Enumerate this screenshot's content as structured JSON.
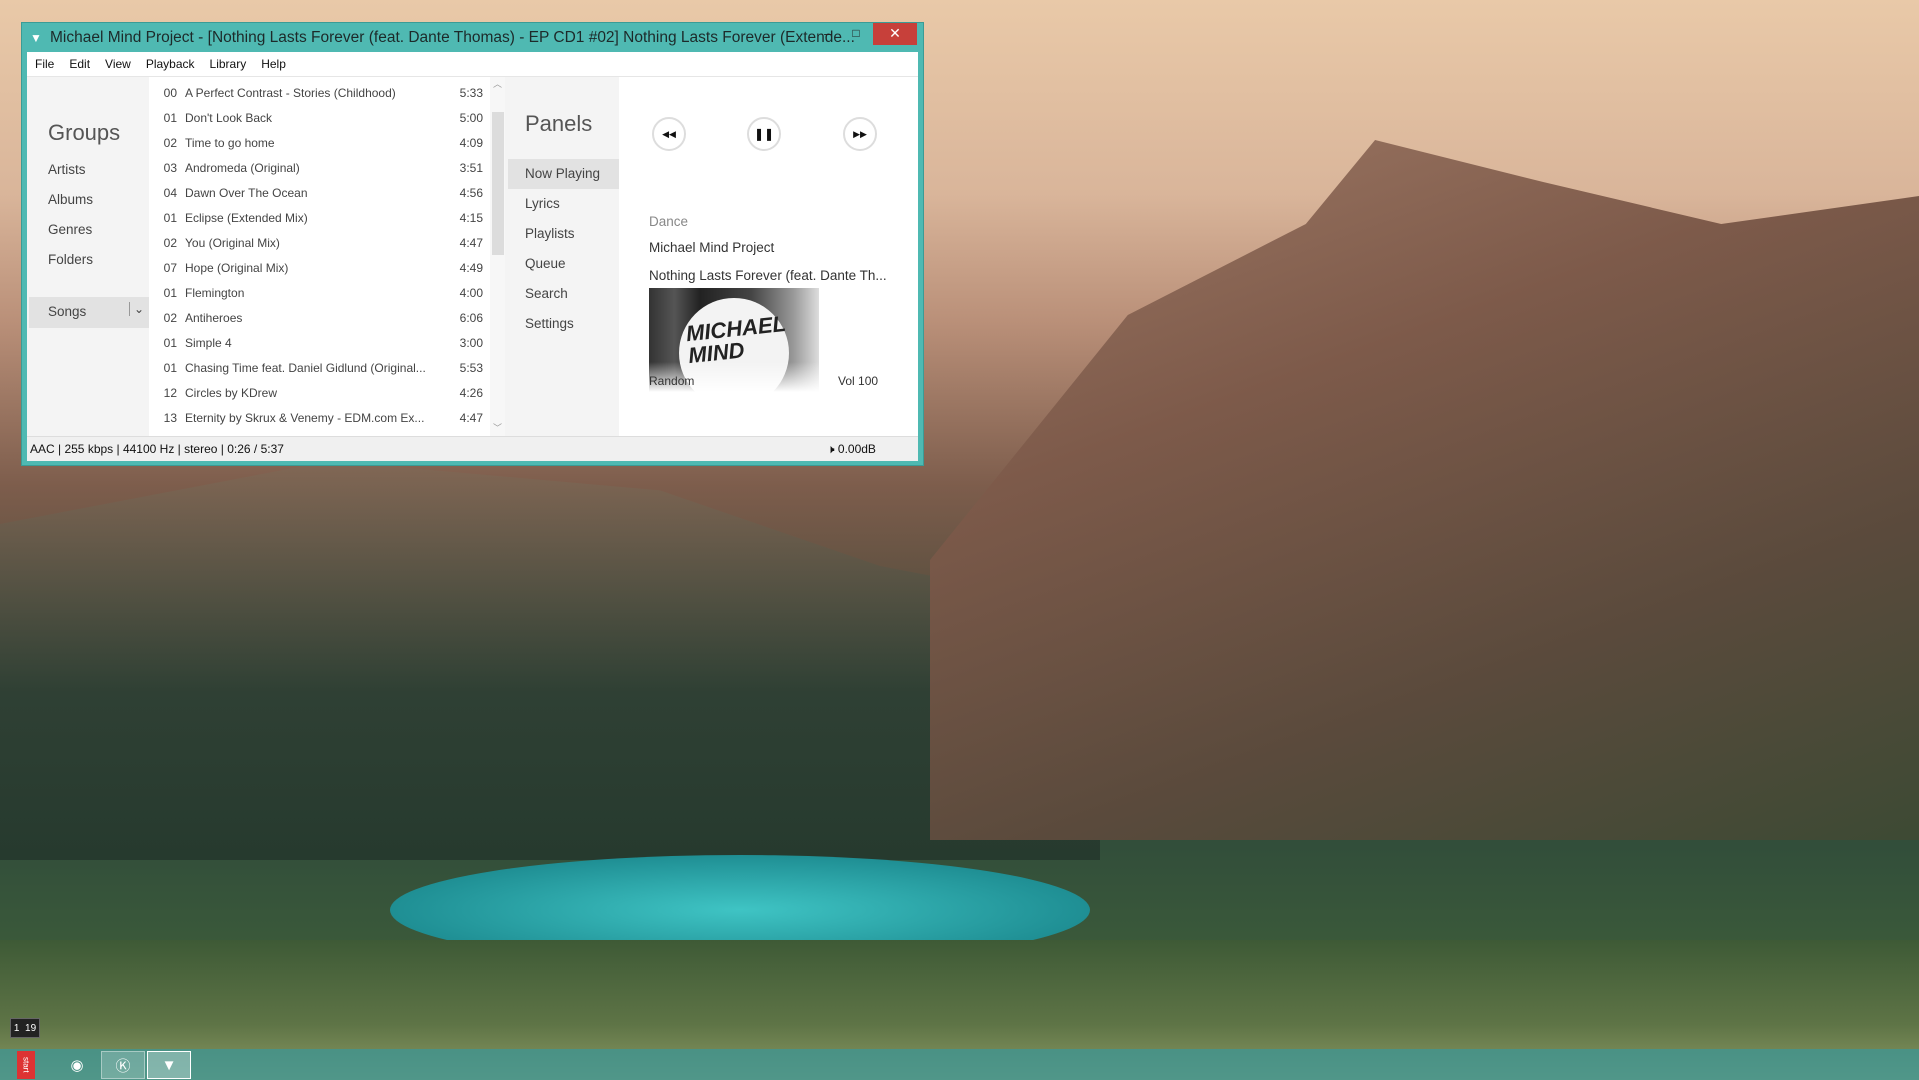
{
  "window": {
    "title": "Michael Mind Project - [Nothing Lasts Forever (feat. Dante Thomas) - EP CD1 #02] Nothing Lasts Forever (Extende...",
    "minimize": "–",
    "maximize": "□",
    "close": "✕"
  },
  "menu": [
    "File",
    "Edit",
    "View",
    "Playback",
    "Library",
    "Help"
  ],
  "groups": {
    "title": "Groups",
    "items": [
      "Artists",
      "Albums",
      "Genres",
      "Folders",
      "Songs"
    ],
    "selected": "Songs"
  },
  "songs": [
    {
      "n": "00",
      "t": "A Perfect Contrast - Stories (Childhood)",
      "d": "5:33"
    },
    {
      "n": "01",
      "t": "Don't Look Back",
      "d": "5:00"
    },
    {
      "n": "02",
      "t": "Time to go home",
      "d": "4:09"
    },
    {
      "n": "03",
      "t": "Andromeda (Original)",
      "d": "3:51"
    },
    {
      "n": "04",
      "t": "Dawn Over The Ocean",
      "d": "4:56"
    },
    {
      "n": "01",
      "t": "Eclipse (Extended Mix)",
      "d": "4:15"
    },
    {
      "n": "02",
      "t": "You (Original Mix)",
      "d": "4:47"
    },
    {
      "n": "07",
      "t": "Hope (Original Mix)",
      "d": "4:49"
    },
    {
      "n": "01",
      "t": "Flemington",
      "d": "4:00"
    },
    {
      "n": "02",
      "t": "Antiheroes",
      "d": "6:06"
    },
    {
      "n": "01",
      "t": "Simple 4",
      "d": "3:00"
    },
    {
      "n": "01",
      "t": "Chasing Time feat. Daniel Gidlund (Original...",
      "d": "5:53"
    },
    {
      "n": "12",
      "t": "Circles by KDrew",
      "d": "4:26"
    },
    {
      "n": "13",
      "t": "Eternity by Skrux & Venemy - EDM.com Ex...",
      "d": "4:47"
    }
  ],
  "panels": {
    "title": "Panels",
    "items": [
      "Now Playing",
      "Lyrics",
      "Playlists",
      "Queue",
      "Search",
      "Settings"
    ],
    "selected": "Now Playing"
  },
  "now_playing": {
    "genre": "Dance",
    "artist": "Michael Mind Project",
    "title": "Nothing Lasts Forever (feat. Dante Th...",
    "art_text": "MICHAEL MIND PROJECT",
    "random": "Random",
    "volume": "Vol 100",
    "controls": {
      "prev": "◀◀",
      "pause": "❚❚",
      "next": "▶▶"
    }
  },
  "status": {
    "info": "AAC | 255 kbps | 44100 Hz | stereo | 0:26 / 5:37",
    "gain": "0.00dB",
    "speaker_icon": "🕨"
  },
  "desktop": {
    "clock_h": "1",
    "clock_m": "19",
    "taskbar_icons": [
      "start-ribbon",
      "chrome-like-icon",
      "k-app-icon",
      "player-app-icon"
    ],
    "start_label": "start"
  }
}
